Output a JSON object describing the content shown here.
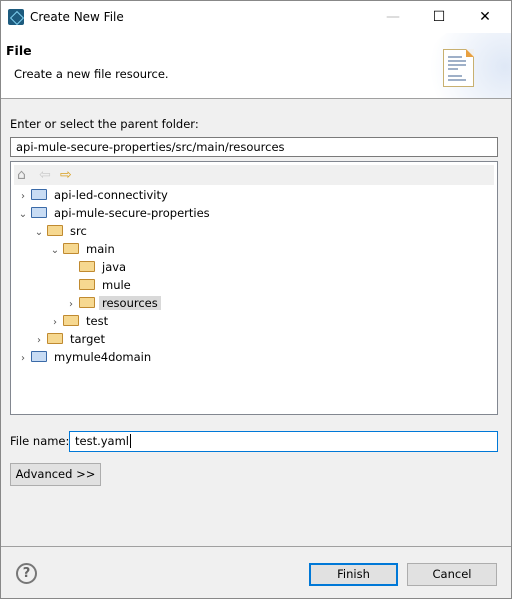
{
  "window": {
    "title": "Create New File"
  },
  "header": {
    "title": "File",
    "description": "Create a new file resource."
  },
  "parent_label": "Enter or select the parent folder:",
  "parent_path": "api-mule-secure-properties/src/main/resources",
  "tree": [
    {
      "label": "api-led-connectivity",
      "level": 0,
      "arrow": "collapsed",
      "type": "project"
    },
    {
      "label": "api-mule-secure-properties",
      "level": 0,
      "arrow": "expanded",
      "type": "project"
    },
    {
      "label": "src",
      "level": 1,
      "arrow": "expanded",
      "type": "folder"
    },
    {
      "label": "main",
      "level": 2,
      "arrow": "expanded",
      "type": "folder"
    },
    {
      "label": "java",
      "level": 3,
      "arrow": "none",
      "type": "folder"
    },
    {
      "label": "mule",
      "level": 3,
      "arrow": "none",
      "type": "folder"
    },
    {
      "label": "resources",
      "level": 3,
      "arrow": "collapsed",
      "type": "folder",
      "selected": true
    },
    {
      "label": "test",
      "level": 2,
      "arrow": "collapsed",
      "type": "folder"
    },
    {
      "label": "target",
      "level": 1,
      "arrow": "collapsed",
      "type": "folder"
    },
    {
      "label": "mymule4domain",
      "level": 0,
      "arrow": "collapsed",
      "type": "project"
    }
  ],
  "file_name_label": "File name:",
  "file_name": "test.yaml",
  "advanced_label": "Advanced >>",
  "finish_label": "Finish",
  "cancel_label": "Cancel",
  "help_glyph": "?"
}
